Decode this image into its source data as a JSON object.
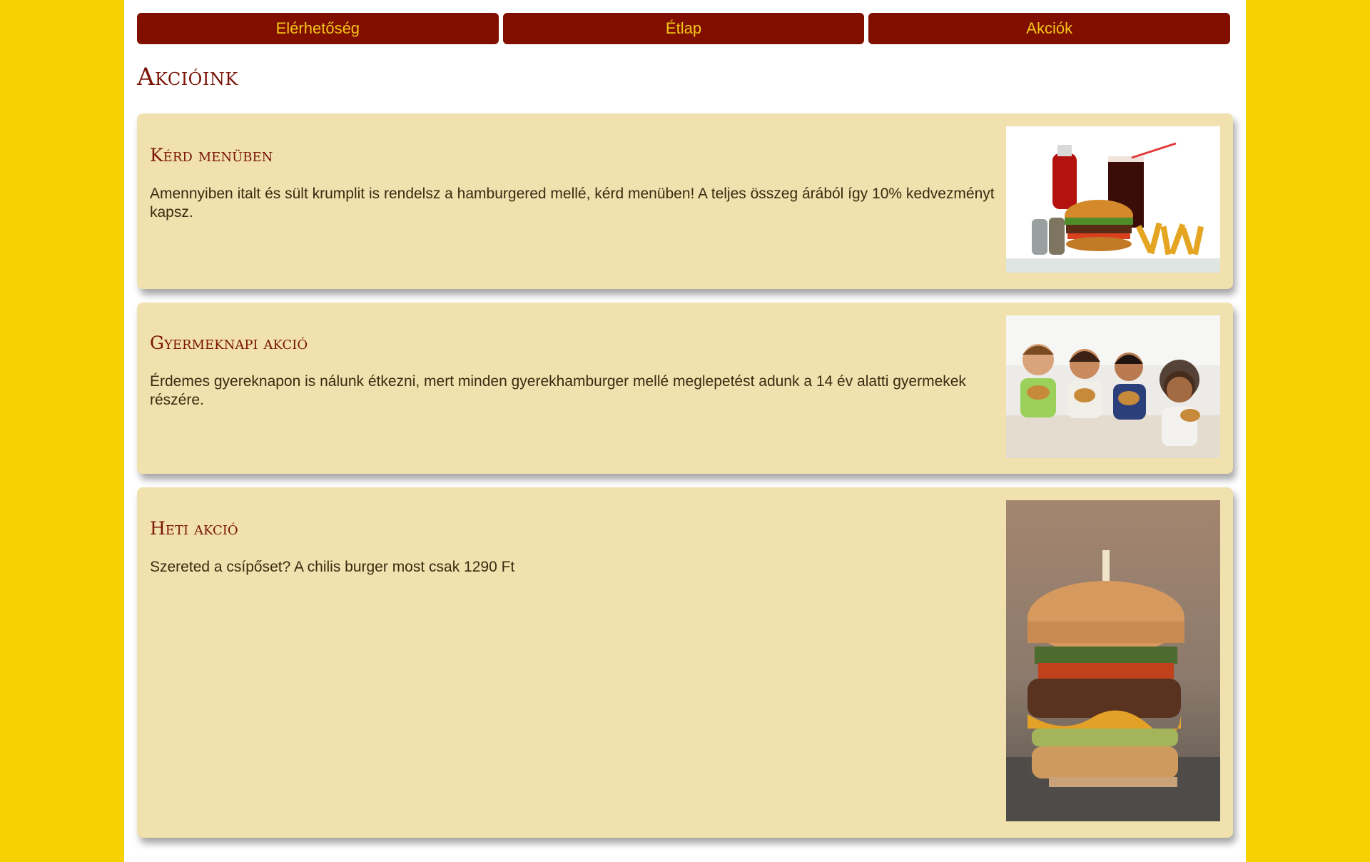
{
  "nav": {
    "items": [
      {
        "label": "Elérhetőség"
      },
      {
        "label": "Étlap"
      },
      {
        "label": "Akciók"
      }
    ]
  },
  "page": {
    "title": "Akcióink"
  },
  "offers": [
    {
      "title": "Kérd menüben",
      "text": "Amennyiben italt és sült krumplit is rendelsz a hamburgered mellé, kérd menüben! A teljes összeg árából így 10% kedvezményt kapsz."
    },
    {
      "title": "Gyermeknapi akció",
      "text": "Érdemes gyereknapon is nálunk étkezni, mert minden gyerekhamburger mellé meglepetést adunk a 14 év alatti gyermekek részére."
    },
    {
      "title": "Heti akció",
      "text": "Szereted a csípőset? A chilis burger most csak 1290 Ft"
    }
  ],
  "colors": {
    "background": "#f7d203",
    "nav_button": "#800f00",
    "nav_text": "#f5c518",
    "card": "#f1e1ae",
    "heading": "#7a1407"
  }
}
